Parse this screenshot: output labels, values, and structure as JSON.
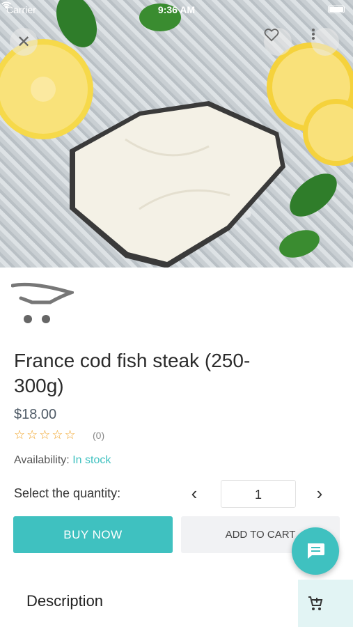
{
  "status_bar": {
    "carrier": "Carrier",
    "time": "9:36 AM"
  },
  "hero": {
    "icons": [
      "close-icon",
      "heart-icon",
      "more-vertical-icon"
    ]
  },
  "product": {
    "title": "France cod fish steak (250-300g)",
    "price": "$18.00",
    "stars": "☆☆☆☆☆",
    "rating_value": 0,
    "review_count": "(0)",
    "availability_label": "Availability:",
    "availability_value": "In stock"
  },
  "quantity": {
    "label": "Select the quantity:",
    "prev": "‹",
    "value": "1",
    "next": "›"
  },
  "actions": {
    "buy_now": "BUY NOW",
    "add_to_cart": "ADD TO CART"
  },
  "description": {
    "title": "Description"
  },
  "colors": {
    "accent": "#3fc1c0",
    "secondary_button": "#f1f2f4",
    "cart_tab_bg": "#e2f4f4"
  }
}
